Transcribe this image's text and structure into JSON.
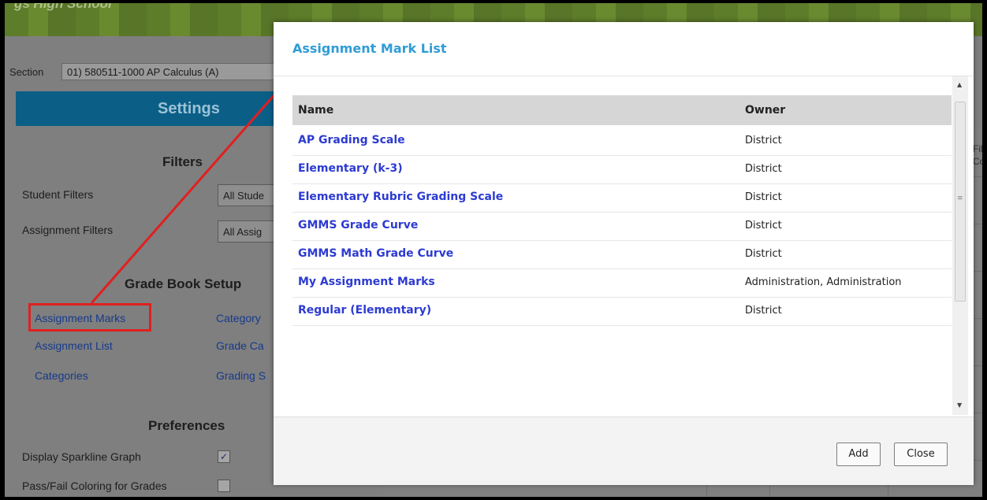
{
  "school_title": "gs High School",
  "section": {
    "label": "Section",
    "value": "01) 580511-1000 AP Calculus (A)"
  },
  "settings": {
    "title": "Settings",
    "filters_heading": "Filters",
    "student_filters_label": "Student Filters",
    "student_filters_value": "All Stude",
    "assignment_filters_label": "Assignment Filters",
    "assignment_filters_value": "All Assig",
    "gradebook_heading": "Grade Book Setup",
    "links": {
      "assignment_marks": "Assignment Marks",
      "assignment_list": "Assignment List",
      "categories": "Categories",
      "category": "Category",
      "grade_ca": "Grade Ca",
      "grading_s": "Grading S"
    },
    "preferences_heading": "Preferences",
    "sparkline_label": "Display Sparkline Graph",
    "sparkline_checked": true,
    "passfail_label": "Pass/Fail Coloring for Grades",
    "passfail_checked": false
  },
  "background_fragments": {
    "fil": "Fil",
    "co": "Co"
  },
  "modal": {
    "title": "Assignment Mark List",
    "columns": {
      "name": "Name",
      "owner": "Owner"
    },
    "rows": [
      {
        "name": "AP Grading Scale",
        "owner": "District"
      },
      {
        "name": "Elementary (k-3)",
        "owner": "District"
      },
      {
        "name": "Elementary Rubric Grading Scale",
        "owner": "District"
      },
      {
        "name": "GMMS Grade Curve",
        "owner": "District"
      },
      {
        "name": "GMMS Math Grade Curve",
        "owner": "District"
      },
      {
        "name": "My Assignment Marks",
        "owner": "Administration, Administration"
      },
      {
        "name": "Regular (Elementary)",
        "owner": "District"
      }
    ],
    "add_label": "Add",
    "close_label": "Close"
  },
  "colors": {
    "accent": "#2f9cd6",
    "link": "#2d3bd1",
    "annotation": "#e02020",
    "settings_bar": "#0b5f87"
  }
}
